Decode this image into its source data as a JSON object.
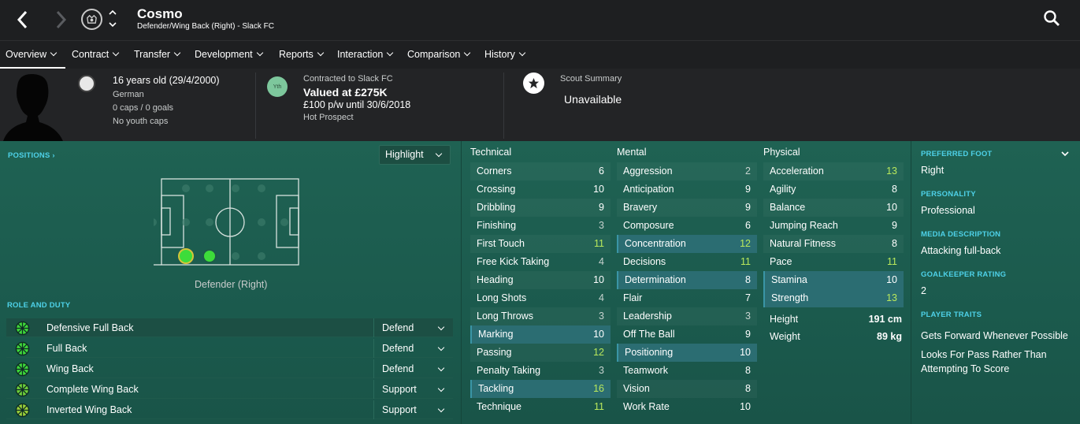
{
  "player": {
    "name": "Cosmo",
    "subtitle": "Defender/Wing Back (Right) - Slack FC",
    "age": "16 years old (29/4/2000)",
    "nationality": "German",
    "caps": "0 caps / 0 goals",
    "youth_caps": "No youth caps"
  },
  "contract": {
    "badge": "Yth",
    "club_line": "Contracted to Slack FC",
    "value": "Valued at £275K",
    "wage": "£100 p/w until 30/6/2018",
    "status": "Hot Prospect"
  },
  "scout": {
    "title": "Scout Summary",
    "value": "Unavailable"
  },
  "menu": [
    {
      "label": "Overview"
    },
    {
      "label": "Contract"
    },
    {
      "label": "Transfer"
    },
    {
      "label": "Development"
    },
    {
      "label": "Reports"
    },
    {
      "label": "Interaction"
    },
    {
      "label": "Comparison"
    },
    {
      "label": "History"
    }
  ],
  "positions": {
    "label": "POSITIONS",
    "highlight_label": "Highlight",
    "position_label": "Defender (Right)"
  },
  "role_duty": {
    "label": "ROLE AND DUTY",
    "rows": [
      {
        "role": "Defensive Full Back",
        "duty": "Defend"
      },
      {
        "role": "Full Back",
        "duty": "Defend"
      },
      {
        "role": "Wing Back",
        "duty": "Defend"
      },
      {
        "role": "Complete Wing Back",
        "duty": "Support"
      },
      {
        "role": "Inverted Wing Back",
        "duty": "Support"
      }
    ]
  },
  "attributes": {
    "technical_label": "Technical",
    "mental_label": "Mental",
    "physical_label": "Physical",
    "technical": [
      {
        "name": "Corners",
        "value": "6"
      },
      {
        "name": "Crossing",
        "value": "10"
      },
      {
        "name": "Dribbling",
        "value": "9"
      },
      {
        "name": "Finishing",
        "value": "3"
      },
      {
        "name": "First Touch",
        "value": "11"
      },
      {
        "name": "Free Kick Taking",
        "value": "4"
      },
      {
        "name": "Heading",
        "value": "10"
      },
      {
        "name": "Long Shots",
        "value": "4"
      },
      {
        "name": "Long Throws",
        "value": "3"
      },
      {
        "name": "Marking",
        "value": "10"
      },
      {
        "name": "Passing",
        "value": "12"
      },
      {
        "name": "Penalty Taking",
        "value": "3"
      },
      {
        "name": "Tackling",
        "value": "16"
      },
      {
        "name": "Technique",
        "value": "11"
      }
    ],
    "mental": [
      {
        "name": "Aggression",
        "value": "2"
      },
      {
        "name": "Anticipation",
        "value": "9"
      },
      {
        "name": "Bravery",
        "value": "9"
      },
      {
        "name": "Composure",
        "value": "6"
      },
      {
        "name": "Concentration",
        "value": "12"
      },
      {
        "name": "Decisions",
        "value": "11"
      },
      {
        "name": "Determination",
        "value": "8"
      },
      {
        "name": "Flair",
        "value": "7"
      },
      {
        "name": "Leadership",
        "value": "3"
      },
      {
        "name": "Off The Ball",
        "value": "9"
      },
      {
        "name": "Positioning",
        "value": "10"
      },
      {
        "name": "Teamwork",
        "value": "8"
      },
      {
        "name": "Vision",
        "value": "8"
      },
      {
        "name": "Work Rate",
        "value": "10"
      }
    ],
    "physical": [
      {
        "name": "Acceleration",
        "value": "13"
      },
      {
        "name": "Agility",
        "value": "8"
      },
      {
        "name": "Balance",
        "value": "10"
      },
      {
        "name": "Jumping Reach",
        "value": "9"
      },
      {
        "name": "Natural Fitness",
        "value": "8"
      },
      {
        "name": "Pace",
        "value": "11"
      },
      {
        "name": "Stamina",
        "value": "10"
      },
      {
        "name": "Strength",
        "value": "13"
      }
    ],
    "height_label": "Height",
    "height": "191 cm",
    "weight_label": "Weight",
    "weight": "89 kg"
  },
  "sidebar": {
    "preferred_foot_label": "PREFERRED FOOT",
    "preferred_foot": "Right",
    "personality_label": "PERSONALITY",
    "personality": "Professional",
    "media_label": "MEDIA DESCRIPTION",
    "media": "Attacking full-back",
    "gk_label": "GOALKEEPER RATING",
    "gk": "2",
    "traits_label": "PLAYER TRAITS",
    "traits": [
      "Gets Forward Whenever Possible",
      "Looks For Pass Rather Than Attempting To Score"
    ]
  },
  "colors": {
    "accent_cyan": "#4ed1e8",
    "good_value": "#b9e85c",
    "position_green": "#3ddc3a",
    "highlight_row": "#2b6d72"
  },
  "icons": [
    "back-arrow-icon",
    "forward-arrow-icon",
    "club-badge-icon",
    "search-icon",
    "star-icon",
    "flag-icon",
    "role-icon",
    "chevron-down-icon"
  ]
}
